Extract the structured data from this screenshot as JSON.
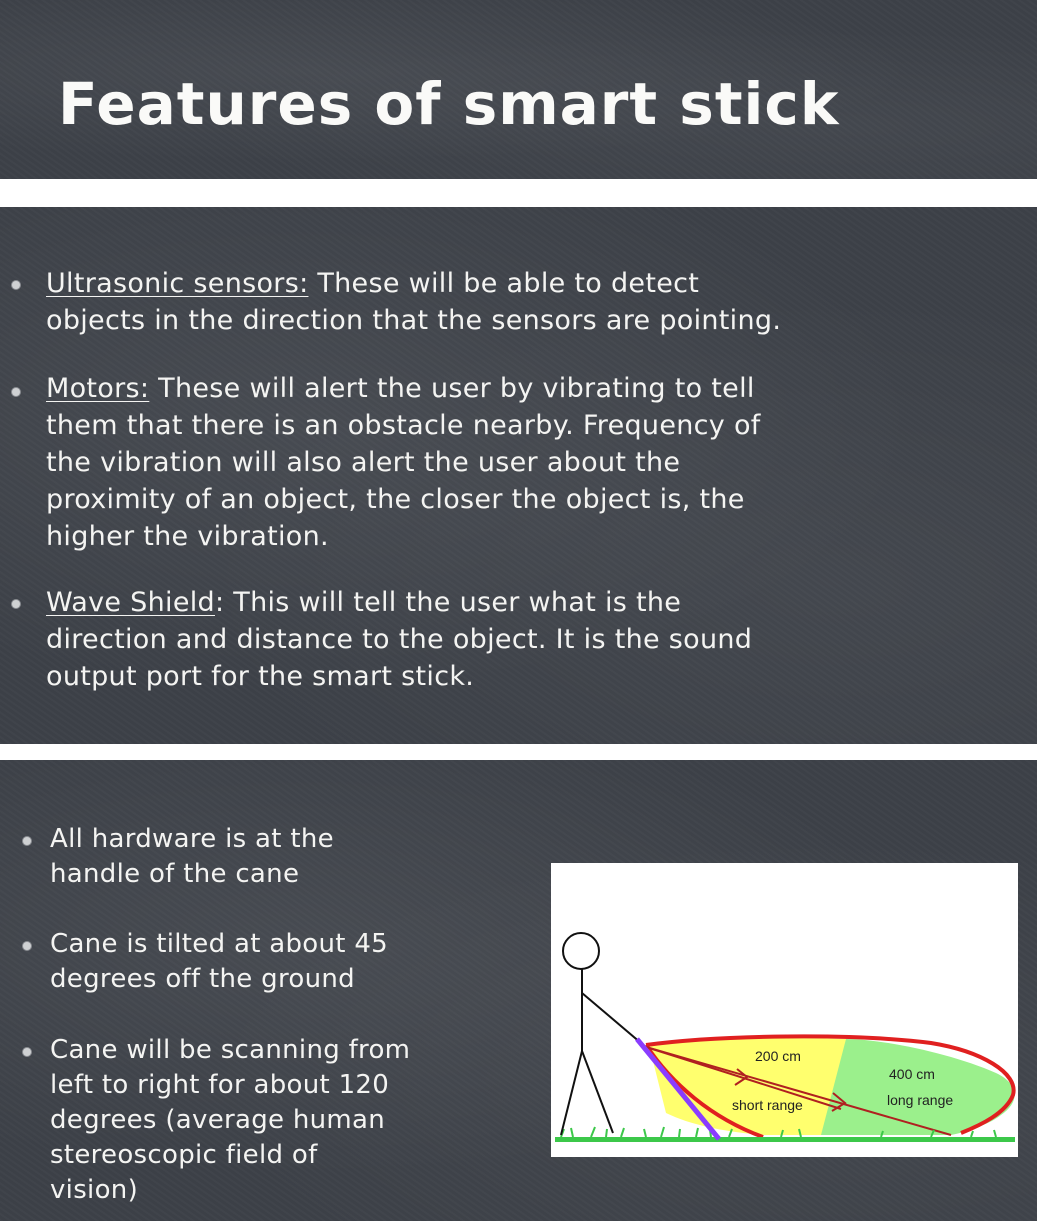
{
  "slide1": {
    "title": "Features of smart stick"
  },
  "slide2": {
    "bullets": [
      {
        "term": "Ultrasonic sensors:",
        "lines": [
          " These will be able to detect",
          "objects in the direction that the sensors are pointing."
        ]
      },
      {
        "term": "Motors:",
        "lines": [
          " These will alert the user by vibrating to tell",
          "them that there is an obstacle nearby. Frequency of",
          "the vibration will also alert the user about the",
          "proximity of an object, the closer the object is, the",
          "higher the vibration."
        ]
      },
      {
        "term": "Wave Shield",
        "lines": [
          ": This will tell the user what is the",
          "direction and distance to the object. It is the sound",
          "output port for the smart stick."
        ]
      }
    ]
  },
  "slide3": {
    "bullets": [
      {
        "lines": [
          "All hardware is at the",
          "handle of the cane"
        ]
      },
      {
        "lines": [
          "Cane is tilted at about 45",
          "degrees off the ground"
        ]
      },
      {
        "lines": [
          "Cane will be scanning from",
          "left to right for about 120",
          "degrees (average human",
          "stereoscopic field of",
          "vision)"
        ]
      }
    ],
    "figure": {
      "short_distance": "200 cm",
      "short_label": "short range",
      "long_distance": "400 cm",
      "long_label": "long range",
      "colors": {
        "short_zone": "#ffff6e",
        "long_zone": "#9bf08c",
        "outline": "#e02020",
        "cane": "#8a3cff",
        "ground": "#3cc84a"
      }
    }
  }
}
